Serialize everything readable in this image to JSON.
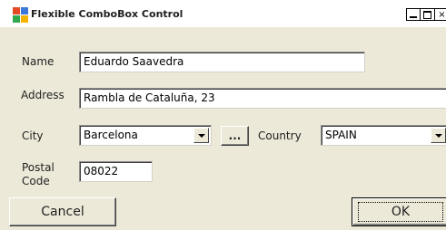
{
  "window": {
    "title": "Flexible ComboBox Control",
    "controls": {
      "minimize": "_",
      "maximize": "□",
      "close": "×"
    },
    "icon_colors": [
      "#e34a26",
      "#3c78d8",
      "#2fa84f",
      "#f4b400"
    ]
  },
  "form": {
    "name": {
      "label": "Name",
      "value": "Eduardo Saavedra"
    },
    "address": {
      "label": "Address",
      "value": "Rambla de Cataluña, 23"
    },
    "city": {
      "label": "City",
      "value": "Barcelona",
      "more_label": "..."
    },
    "country": {
      "label": "Country",
      "value": "SPAIN"
    },
    "postal": {
      "label_line1": "Postal",
      "label_line2": "Code",
      "value": "08022"
    }
  },
  "buttons": {
    "cancel": "Cancel",
    "ok": "OK"
  }
}
